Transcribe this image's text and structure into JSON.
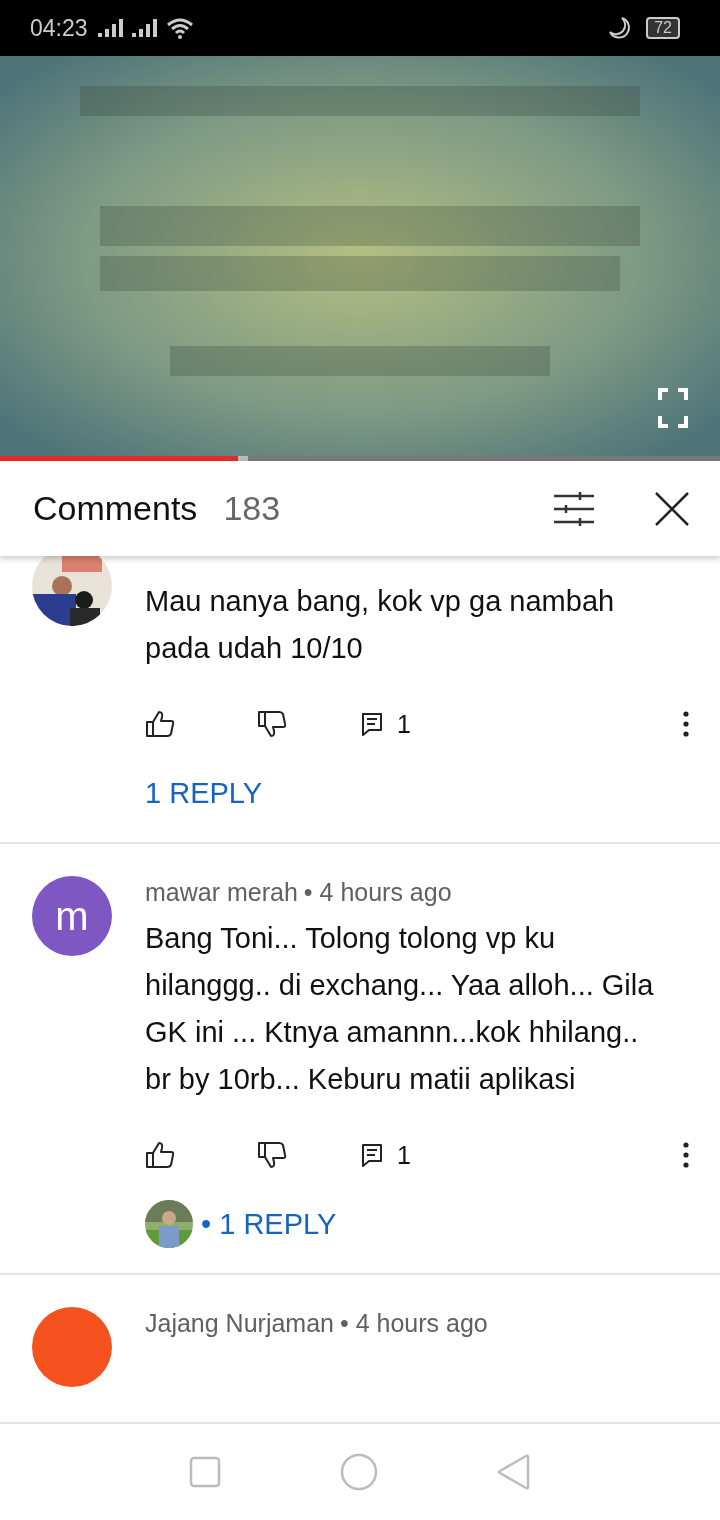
{
  "status_bar": {
    "time": "04:23",
    "battery": "72"
  },
  "video": {
    "kind": "picture",
    "progress": {
      "level": 0.33
    }
  },
  "comments_header": {
    "title": "Comments",
    "count": "183"
  },
  "comments": [
    {
      "text": "Mau nanya bang, kok vp ga nambah pada udah 10/10",
      "reply_count": "1",
      "replies": {
        "label": "1 REPLY",
        "avatar": false
      }
    },
    {
      "author": "mawar merah",
      "time": "• 4 hours ago",
      "avatar": {
        "kind": "letter",
        "letter": "m",
        "color": "#7e57c2"
      },
      "text": "Bang Toni... Tolong tolong vp ku hilanggg.. di exchang... Yaa alloh... Gila GK ini ... Ktnya amannn...kok hhilang.. br by 10rb... Keburu matii aplikasi",
      "reply_count": "1",
      "replies": {
        "label": "• 1 REPLY",
        "avatar": true
      }
    },
    {
      "author": "Jajang Nurjaman",
      "time": "• 4 hours ago",
      "avatar": {
        "kind": "letter",
        "color": "#f4511e"
      }
    }
  ]
}
